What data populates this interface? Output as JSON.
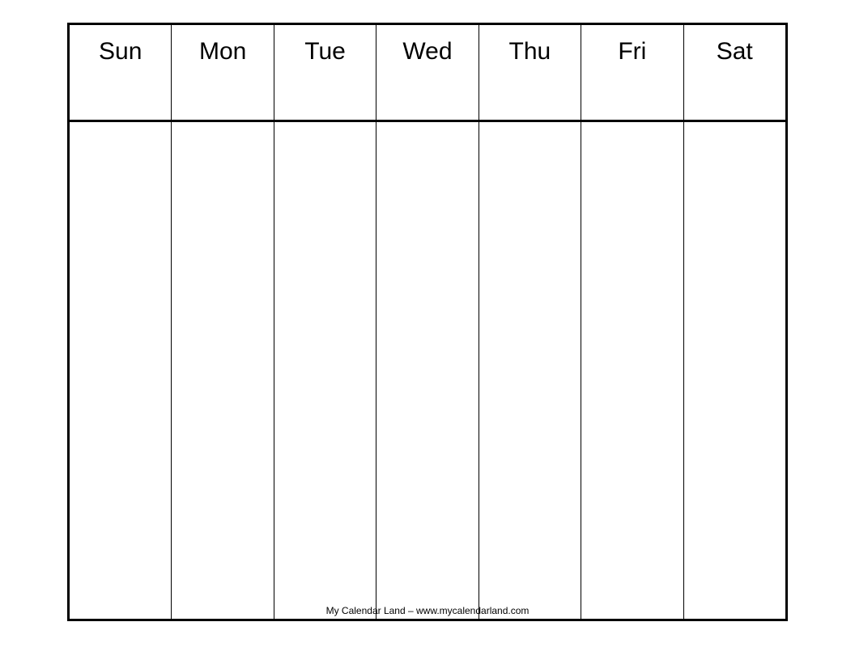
{
  "calendar": {
    "days": [
      {
        "label": "Sun"
      },
      {
        "label": "Mon"
      },
      {
        "label": "Tue"
      },
      {
        "label": "Wed"
      },
      {
        "label": "Thu"
      },
      {
        "label": "Fri"
      },
      {
        "label": "Sat"
      }
    ]
  },
  "footer": {
    "attribution": "My Calendar Land – www.mycalendarland.com"
  }
}
